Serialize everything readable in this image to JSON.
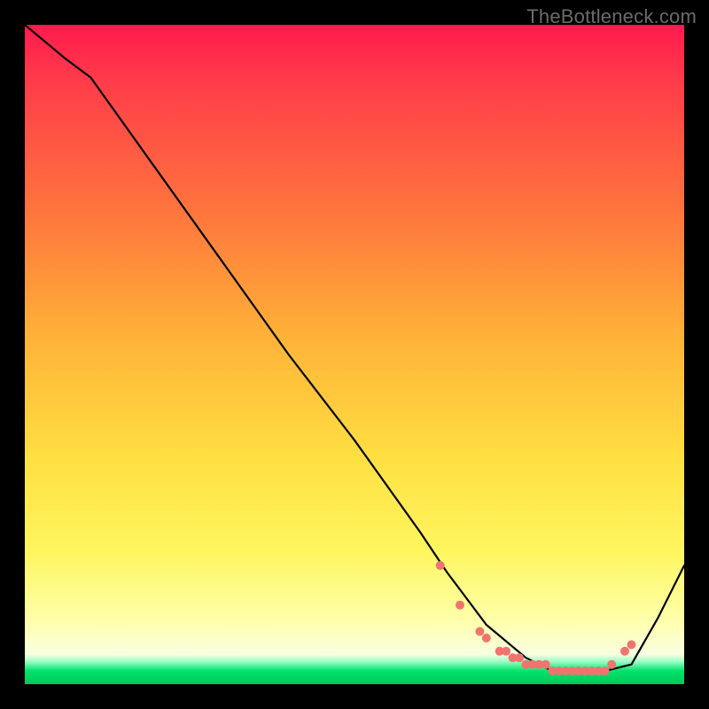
{
  "watermark": "TheBottleneck.com",
  "chart_data": {
    "type": "line",
    "title": "",
    "xlabel": "",
    "ylabel": "",
    "xlim": [
      0,
      100
    ],
    "ylim": [
      0,
      100
    ],
    "series": [
      {
        "name": "bottleneck-curve",
        "x": [
          0,
          6,
          10,
          20,
          30,
          40,
          50,
          60,
          64,
          70,
          76,
          80,
          84,
          88,
          92,
          96,
          100
        ],
        "values": [
          100,
          95,
          92,
          78,
          64,
          50,
          37,
          23,
          17,
          9,
          4,
          2,
          2,
          2,
          3,
          10,
          18
        ]
      }
    ],
    "markers": {
      "name": "highlight-dots",
      "color": "#f0746e",
      "x": [
        63,
        66,
        69,
        70,
        72,
        73,
        74,
        75,
        76,
        77,
        78,
        79,
        80,
        81,
        82,
        83,
        84,
        85,
        86,
        87,
        88,
        89,
        91,
        92
      ],
      "values": [
        18,
        12,
        8,
        7,
        5,
        5,
        4,
        4,
        3,
        3,
        3,
        3,
        2,
        2,
        2,
        2,
        2,
        2,
        2,
        2,
        2,
        3,
        5,
        6
      ]
    },
    "gradient_stops": [
      {
        "pos": 0,
        "color": "#ff1a4d"
      },
      {
        "pos": 0.3,
        "color": "#ff7a3c"
      },
      {
        "pos": 0.66,
        "color": "#ffe042"
      },
      {
        "pos": 0.9,
        "color": "#ffffa8"
      },
      {
        "pos": 0.98,
        "color": "#00e36a"
      },
      {
        "pos": 1.0,
        "color": "#00c859"
      }
    ]
  }
}
